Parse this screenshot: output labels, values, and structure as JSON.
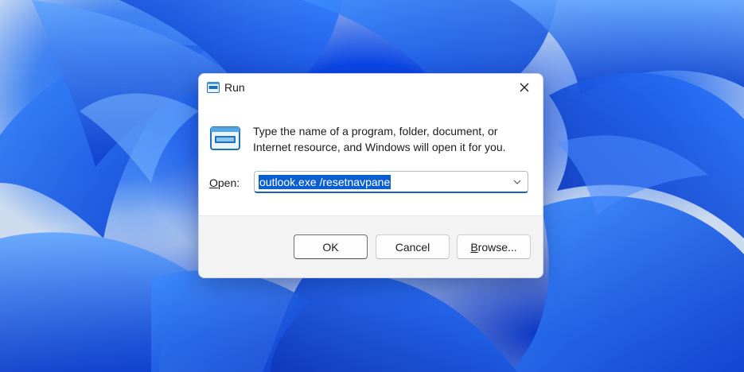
{
  "window": {
    "title": "Run",
    "title_icon": "run-icon",
    "close_icon": "close-icon"
  },
  "dialog": {
    "icon": "run-icon",
    "description": "Type the name of a program, folder, document, or Internet resource, and Windows will open it for you.",
    "open_label_access_key": "O",
    "open_label_rest": "pen:",
    "input_value": "outlook.exe /resetnavpane",
    "dropdown_icon": "chevron-down-icon"
  },
  "buttons": {
    "ok_label": "OK",
    "cancel_label": "Cancel",
    "browse_access_key": "B",
    "browse_rest": "rowse..."
  },
  "colors": {
    "accent": "#0a5fd0",
    "wallpaper_blue": "#0a47e6"
  }
}
